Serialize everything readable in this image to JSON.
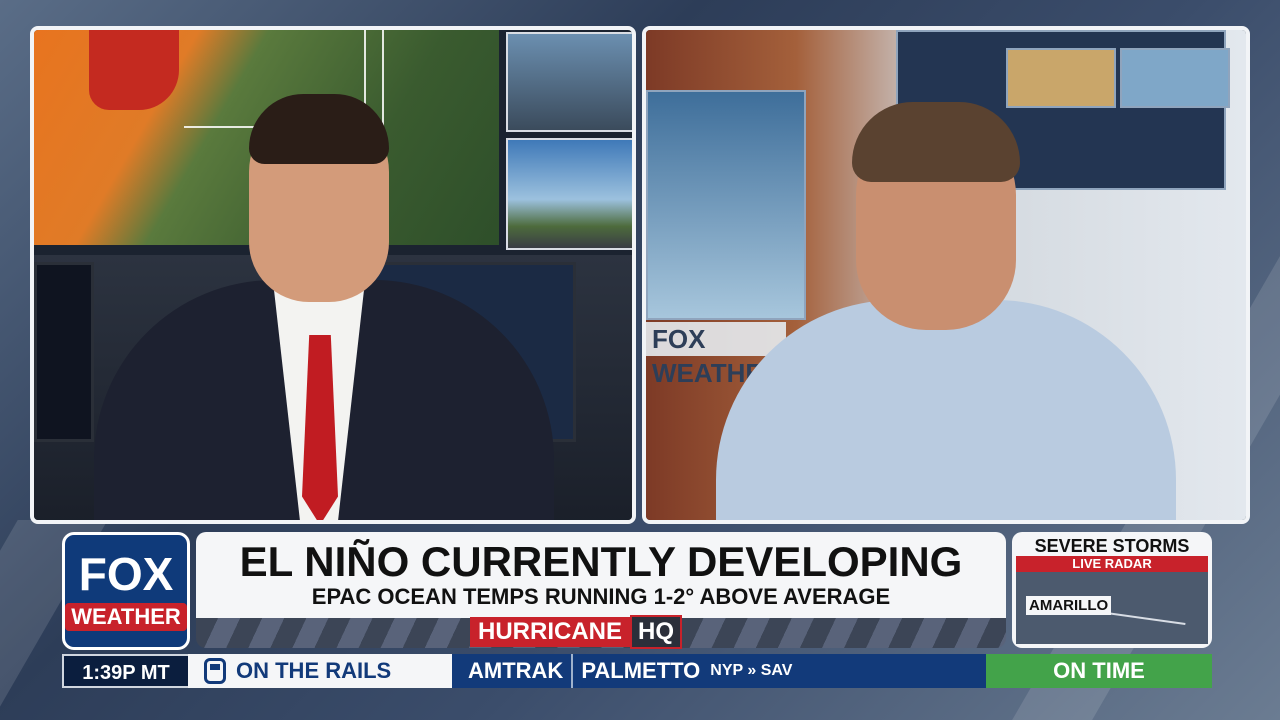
{
  "colors": {
    "fox_blue": "#0f3a7a",
    "fox_red": "#c8222b",
    "ticker_green": "#43a34a"
  },
  "logo": {
    "line1": "FOX",
    "line2": "WEATHER"
  },
  "headline": {
    "title": "EL NIÑO CURRENTLY DEVELOPING",
    "subtitle": "EPAC OCEAN TEMPS RUNNING 1-2° ABOVE AVERAGE"
  },
  "show_tag": {
    "part1": "HURRICANE",
    "part2": "HQ"
  },
  "radar": {
    "title": "SEVERE STORMS",
    "live": "LIVE RADAR",
    "city": "AMARILLO"
  },
  "set_sign": "FOX WEATHER",
  "ticker": {
    "time": "1:39P MT",
    "topic": "ON THE RAILS",
    "carrier": "AMTRAK",
    "route": "PALMETTO",
    "route_detail": "NYP » SAV",
    "status": "ON TIME"
  }
}
